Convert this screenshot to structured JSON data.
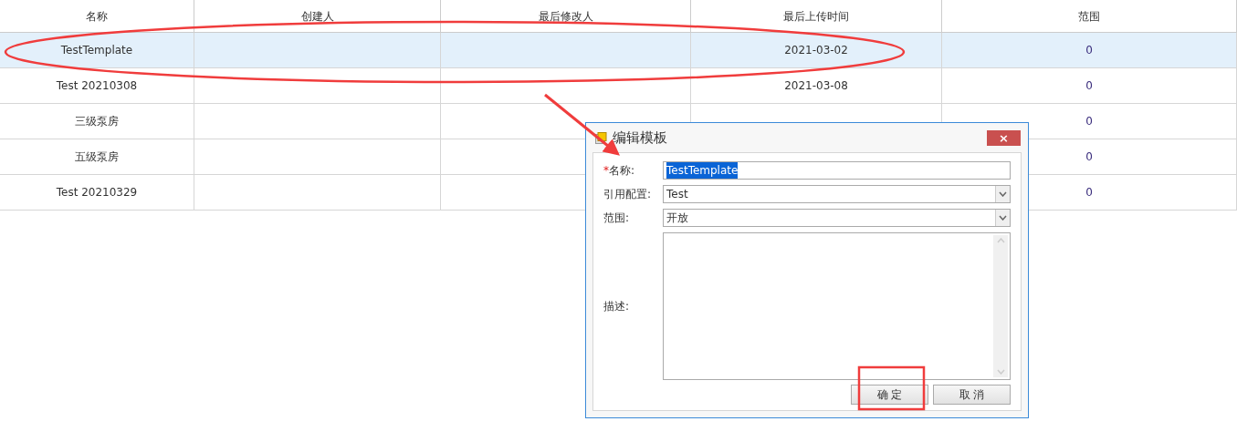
{
  "table": {
    "columns": [
      "名称",
      "创建人",
      "最后修改人",
      "最后上传时间",
      "范围"
    ],
    "rows": [
      {
        "cells": [
          "TestTemplate",
          "",
          "",
          "2021-03-02",
          "0"
        ],
        "selected": true
      },
      {
        "cells": [
          "Test 20210308",
          "",
          "",
          "2021-03-08",
          "0"
        ],
        "selected": false
      },
      {
        "cells": [
          "三级泵房",
          "",
          "",
          "",
          "0"
        ],
        "selected": false
      },
      {
        "cells": [
          "五级泵房",
          "",
          "",
          "",
          "0"
        ],
        "selected": false
      },
      {
        "cells": [
          "Test 20210329",
          "",
          "",
          "",
          "0"
        ],
        "selected": false
      }
    ]
  },
  "dialog": {
    "title": "编辑模板",
    "close": "×",
    "fields": [
      {
        "kind": "text",
        "label": "名称:",
        "required_mark": "*",
        "value": "TestTemplate",
        "text_selected": true
      },
      {
        "kind": "select",
        "label": "引用配置:",
        "value": "Test"
      },
      {
        "kind": "select",
        "label": "范围:",
        "value": "开放"
      },
      {
        "kind": "textarea",
        "label": "描述:"
      }
    ],
    "buttons": [
      "确 定",
      "取 消"
    ]
  },
  "annotations": [
    {
      "kind": "ellipse"
    },
    {
      "kind": "arrow"
    },
    {
      "kind": "rectangle"
    }
  ]
}
